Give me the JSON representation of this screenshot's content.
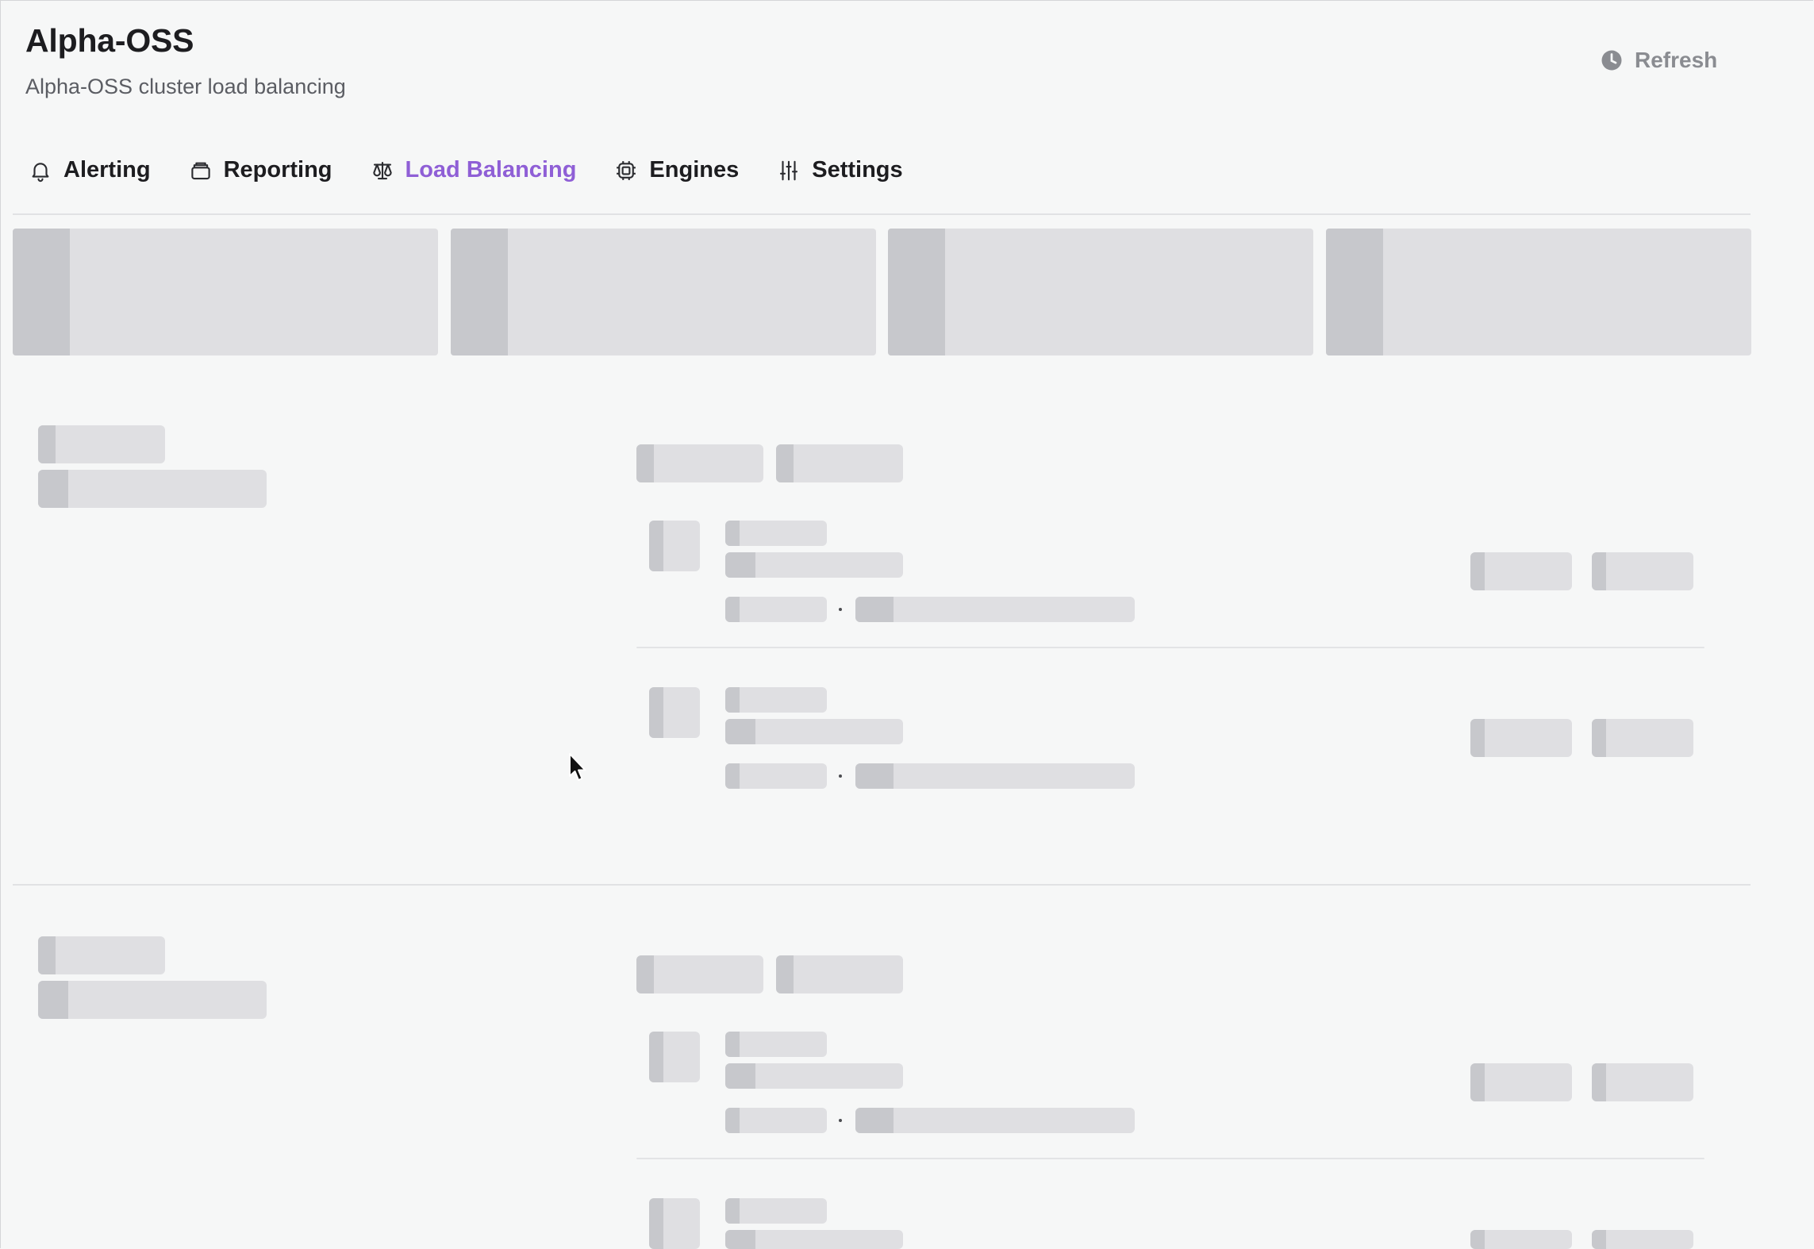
{
  "header": {
    "title": "Alpha-OSS",
    "subtitle": "Alpha-OSS cluster load balancing",
    "refresh_label": "Refresh",
    "refresh_icon": "clock-icon"
  },
  "tabs": [
    {
      "label": "Alerting",
      "icon": "bell-icon",
      "active": false
    },
    {
      "label": "Reporting",
      "icon": "archive-icon",
      "active": false
    },
    {
      "label": "Load Balancing",
      "icon": "scale-icon",
      "active": true
    },
    {
      "label": "Engines",
      "icon": "cpu-icon",
      "active": false
    },
    {
      "label": "Settings",
      "icon": "sliders-icon",
      "active": false
    }
  ],
  "colors": {
    "accent": "#8f5fd6",
    "background": "#f6f7f7",
    "skeleton": "#dfdfe2",
    "skeleton_edge": "#c7c8cc"
  },
  "state": "loading"
}
